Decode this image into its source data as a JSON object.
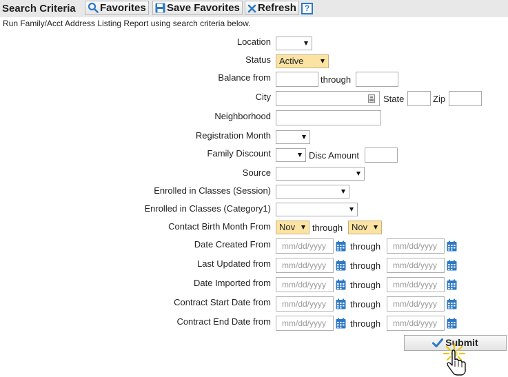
{
  "toolbar": {
    "title": "Search Criteria",
    "favorites": "Favorites",
    "save_favorites": "Save Favorites",
    "refresh": "Refresh",
    "help": "?"
  },
  "subtitle": "Run Family/Acct Address Listing Report using search criteria below.",
  "fields": {
    "location": "Location",
    "status": "Status",
    "status_value": "Active",
    "balance_from": "Balance from",
    "city": "City",
    "state": "State",
    "zip": "Zip",
    "neighborhood": "Neighborhood",
    "registration_month": "Registration Month",
    "family_discount": "Family Discount",
    "disc_amount": "Disc Amount",
    "source": "Source",
    "enrolled_session": "Enrolled in Classes (Session)",
    "enrolled_category": "Enrolled in Classes (Category1)",
    "contact_birth_month": "Contact Birth Month From",
    "birth_from_value": "Nov",
    "birth_to_value": "Nov",
    "date_created": "Date Created From",
    "last_updated": "Last Updated from",
    "date_imported": "Date Imported from",
    "contract_start": "Contract Start Date from",
    "contract_end": "Contract End Date from"
  },
  "through": "through",
  "date_placeholder": "mm/dd/yyyy",
  "submit": "Submit",
  "colors": {
    "accent": "#2d79c4",
    "highlight_select": "#fbe3a3",
    "cursor_spark": "#f2c200"
  }
}
